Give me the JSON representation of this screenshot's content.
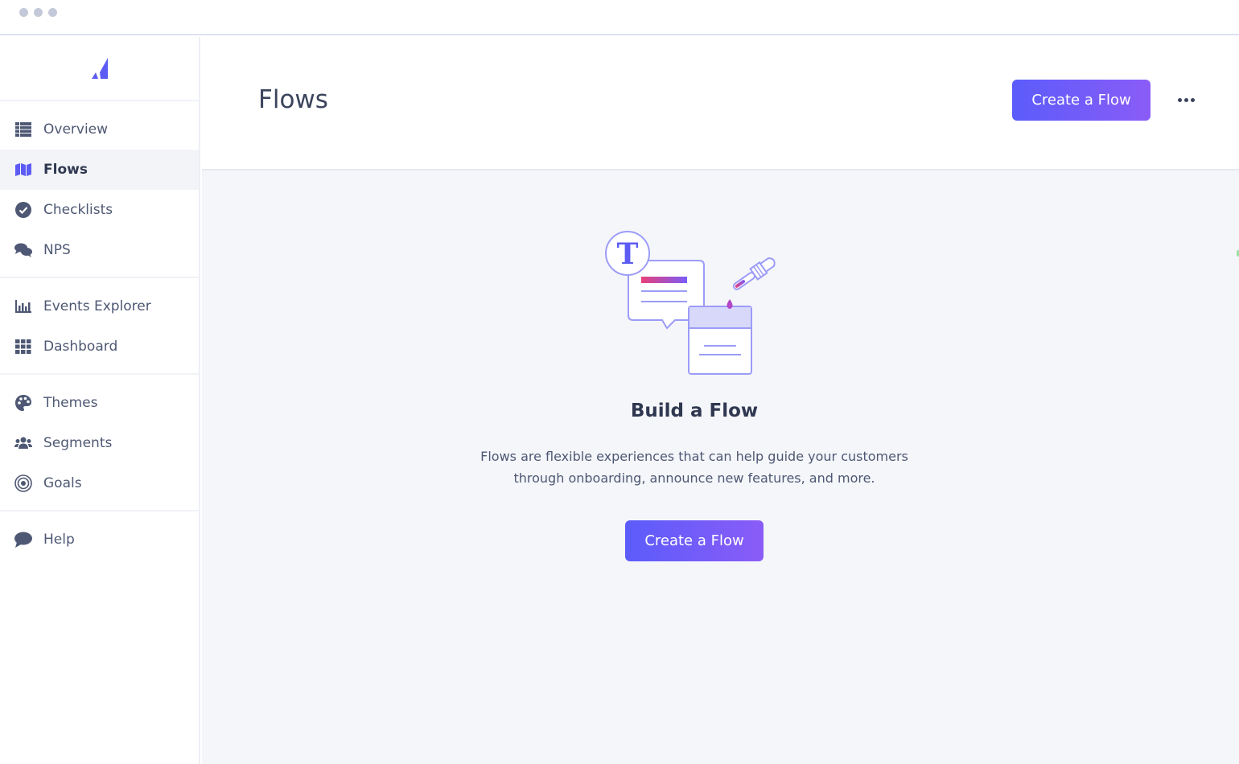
{
  "window": {
    "controls": [
      "dot",
      "dot",
      "dot"
    ]
  },
  "sidebar": {
    "logo": "appcues-logo-icon",
    "groups": [
      [
        {
          "label": "Overview",
          "icon": "list-icon",
          "active": false
        },
        {
          "label": "Flows",
          "icon": "map-icon",
          "active": true
        },
        {
          "label": "Checklists",
          "icon": "check-circle-icon",
          "active": false
        },
        {
          "label": "NPS",
          "icon": "comments-icon",
          "active": false
        }
      ],
      [
        {
          "label": "Events Explorer",
          "icon": "bar-chart-icon",
          "active": false
        },
        {
          "label": "Dashboard",
          "icon": "grid-icon",
          "active": false
        }
      ],
      [
        {
          "label": "Themes",
          "icon": "palette-icon",
          "active": false
        },
        {
          "label": "Segments",
          "icon": "users-icon",
          "active": false
        },
        {
          "label": "Goals",
          "icon": "target-icon",
          "active": false
        }
      ],
      [
        {
          "label": "Help",
          "icon": "chat-bubble-icon",
          "active": false
        }
      ]
    ]
  },
  "header": {
    "title": "Flows",
    "create_button": "Create a Flow",
    "more_icon": "ellipsis-icon"
  },
  "empty_state": {
    "illustration": "flow-builder-illustration",
    "title": "Build a Flow",
    "description_line1": "Flows are flexible experiences that can help guide your customers",
    "description_line2": "through onboarding, announce new features, and more.",
    "create_button": "Create a Flow"
  },
  "colors": {
    "accent_start": "#5b5cfb",
    "accent_end": "#8a5cf7",
    "brand": "#5c5cf5",
    "text": "#4e5874",
    "heading": "#2f3850",
    "background": "#f5f6fa"
  }
}
